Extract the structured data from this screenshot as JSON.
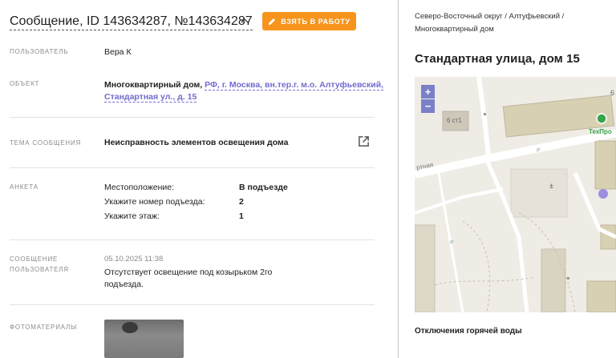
{
  "header": {
    "title": "Сообщение, ID 143634287, №143634287",
    "take_button": "ВЗЯТЬ В РАБОТУ"
  },
  "fields": {
    "user": {
      "label": "ПОЛЬЗОВАТЕЛЬ",
      "value": "Вера К"
    },
    "object": {
      "label": "ОБЪЕКТ",
      "type": "Многоквартирный дом,",
      "address_line1": "РФ, г. Москва, вн.тер.г. м.о. Алтуфьевский,",
      "address_line2": "Стандартная ул., д. 15"
    },
    "topic": {
      "label": "ТЕМА СООБЩЕНИЯ",
      "value": "Неисправность элементов освещения дома"
    },
    "survey": {
      "label": "АНКЕТА",
      "rows": [
        {
          "q": "Местоположение:",
          "a": "В подъезде"
        },
        {
          "q": "Укажите номер подъезда:",
          "a": "2"
        },
        {
          "q": "Укажите этаж:",
          "a": "1"
        }
      ]
    },
    "message": {
      "label_line1": "СООБЩЕНИЕ",
      "label_line2": "ПОЛЬЗОВАТЕЛЯ",
      "date": "05.10.2025 11:38",
      "text_line1": "Отсутствует освещение под козырьком 2го",
      "text_line2": "подъезда."
    },
    "photos": {
      "label": "ФОТОМАТЕРИАЛЫ"
    }
  },
  "side": {
    "breadcrumb_line1": "Северо-Восточный округ / Алтуфьевский /",
    "breadcrumb_line2": "Многоквартирный дом",
    "title": "Стандартная улица, дом 15",
    "map": {
      "zoom_in": "+",
      "zoom_out": "−",
      "building_label": "6 ст1",
      "building_label2": "6",
      "poi_label": "ТехПро",
      "street_label": "ртная",
      "parking1": "P",
      "parking2": "P"
    },
    "section_title": "Отключения горячей воды"
  },
  "colors": {
    "accent_orange": "#f7941d",
    "link_purple": "#6f6bcf",
    "zoom_button": "#7b7fc8",
    "map_bg": "#efece6",
    "poi_green": "#3aa44a"
  }
}
